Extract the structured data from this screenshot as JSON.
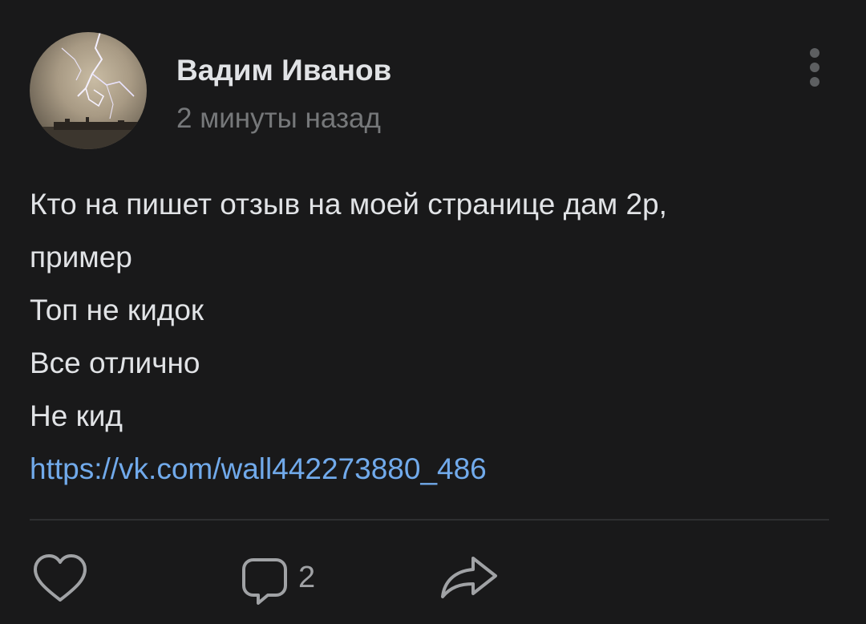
{
  "post": {
    "author": {
      "name": "Вадим Иванов",
      "avatar_icon": "lightning-storm-photo"
    },
    "time": "2 минуты назад",
    "more_icon": "vertical-dots-icon",
    "text_lines": [
      "Кто на пишет отзыв на моей странице дам 2р,",
      "пример",
      "Топ не кидок",
      "Все отлично",
      "Не кид"
    ],
    "link": "https://vk.com/wall442273880_486"
  },
  "actions": {
    "like_icon": "heart-icon",
    "comment_icon": "comment-bubble-icon",
    "comment_count": "2",
    "share_icon": "share-arrow-icon"
  },
  "colors": {
    "background": "#19191a",
    "text": "#e1e3e6",
    "secondary_text": "#76787a",
    "link": "#71aaeb",
    "icon": "#a0a2a5"
  }
}
